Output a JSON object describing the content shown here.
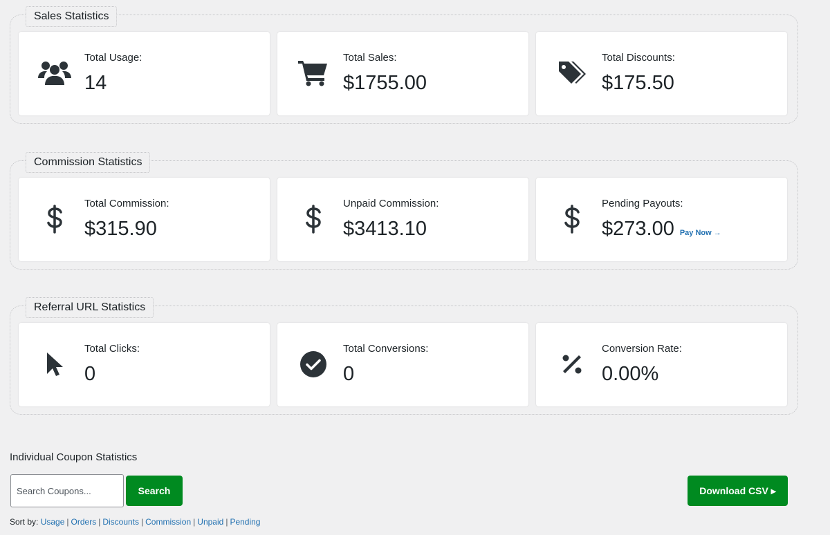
{
  "sales": {
    "title": "Sales Statistics",
    "cards": [
      {
        "icon": "users-icon",
        "label": "Total Usage:",
        "value": "14"
      },
      {
        "icon": "shopping-cart-icon",
        "label": "Total Sales:",
        "value": "$1755.00"
      },
      {
        "icon": "tags-icon",
        "label": "Total Discounts:",
        "value": "$175.50"
      }
    ]
  },
  "commission": {
    "title": "Commission Statistics",
    "cards": [
      {
        "icon": "dollar-icon",
        "label": "Total Commission:",
        "value": "$315.90"
      },
      {
        "icon": "dollar-icon",
        "label": "Unpaid Commission:",
        "value": "$3413.10"
      },
      {
        "icon": "dollar-icon",
        "label": "Pending Payouts:",
        "value": "$273.00",
        "link": "Pay Now →"
      }
    ]
  },
  "referral": {
    "title": "Referral URL Statistics",
    "cards": [
      {
        "icon": "pointer-icon",
        "label": "Total Clicks:",
        "value": "0"
      },
      {
        "icon": "check-circle-icon",
        "label": "Total Conversions:",
        "value": "0"
      },
      {
        "icon": "percent-icon",
        "label": "Conversion Rate:",
        "value": "0.00%"
      }
    ]
  },
  "coupons": {
    "heading": "Individual Coupon Statistics",
    "search_placeholder": "Search Coupons...",
    "search_value": "",
    "search_label": "Search",
    "download_label": "Download CSV ▸",
    "sort_label": "Sort by:",
    "sort_options": [
      "Usage",
      "Orders",
      "Discounts",
      "Commission",
      "Unpaid",
      "Pending"
    ]
  },
  "colors": {
    "accent_green": "#008a20",
    "link_blue": "#2271b1",
    "background": "#f0f0f1"
  }
}
